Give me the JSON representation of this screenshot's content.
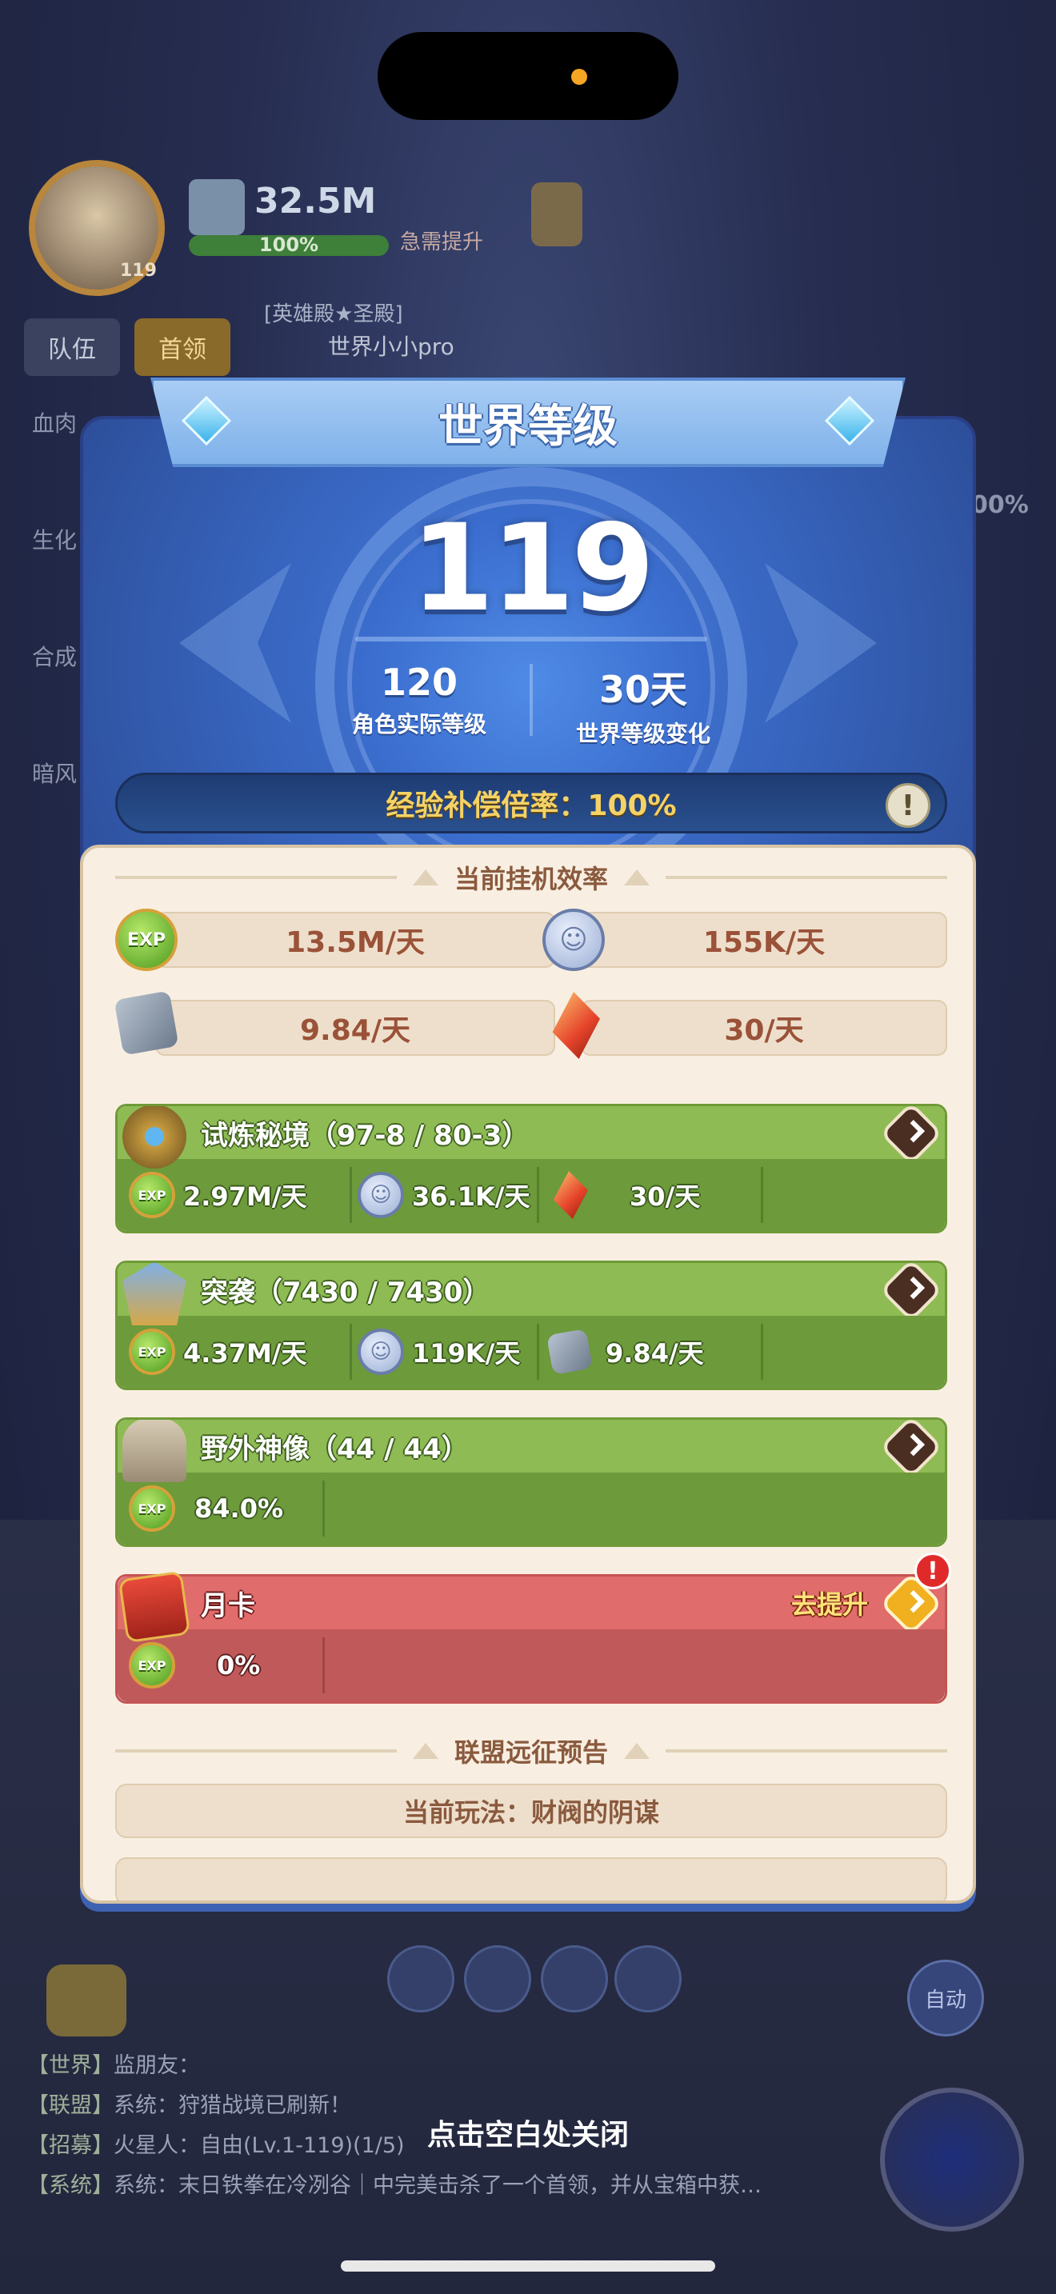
{
  "hud": {
    "level": "119",
    "power": "32.5M",
    "power_pct": "100%",
    "boost": "急需提升",
    "tabs": [
      "队伍",
      "首领"
    ],
    "guild_line1": "[英雄殿★圣殿]",
    "guild_line2": "世界小小pro",
    "side_labels": [
      "血肉",
      "生化",
      "合成",
      "暗风"
    ],
    "side_pct": "00%",
    "auto": "自动"
  },
  "modal": {
    "title": "世界等级",
    "world_level": "119",
    "actual_level_value": "120",
    "actual_level_label": "角色实际等级",
    "change_value": "30天",
    "change_label": "世界等级变化",
    "exp_rate": "经验补偿倍率：100%",
    "warn": "!",
    "efficiency_title": "当前挂机效率",
    "efficiency": {
      "exp": "13.5M/天",
      "coin": "155K/天",
      "stone": "9.84/天",
      "crystal": "30/天"
    },
    "cards": [
      {
        "title": "试炼秘境（97-8 / 80-3）",
        "items": [
          {
            "icon": "exp-icon",
            "value": "2.97M/天"
          },
          {
            "icon": "coin-icon",
            "value": "36.1K/天"
          },
          {
            "icon": "crystal-icon",
            "value": "30/天"
          }
        ]
      },
      {
        "title": "突袭（7430 / 7430）",
        "items": [
          {
            "icon": "exp-icon",
            "value": "4.37M/天"
          },
          {
            "icon": "coin-icon",
            "value": "119K/天"
          },
          {
            "icon": "stone-icon",
            "value": "9.84/天"
          }
        ]
      },
      {
        "title": "野外神像（44 / 44）",
        "items": [
          {
            "icon": "exp-icon",
            "value": "84.0%"
          }
        ]
      },
      {
        "title": "月卡",
        "upgrade": "去提升",
        "alert": "!",
        "items": [
          {
            "icon": "exp-icon",
            "value": "0%"
          }
        ]
      }
    ],
    "alliance_title": "联盟远征预告",
    "alliance_current": "当前玩法：财阀的阴谋"
  },
  "chat": [
    {
      "channel": "【世界】",
      "text": "监朋友："
    },
    {
      "channel": "【联盟】",
      "text": "系统：狩猎战境已刷新！"
    },
    {
      "channel": "【招募】",
      "text": "火星人：自由(Lv.1-119)(1/5)"
    },
    {
      "channel": "【系统】",
      "text": "系统：末日铁拳在冷冽谷｜中完美击杀了一个首领，并从宝箱中获…"
    }
  ],
  "close_hint": "点击空白处关闭",
  "colors": {
    "panel_blue": "#3968c4",
    "card_green": "#8fbb54",
    "card_red": "#e06c6c",
    "cream": "#f8efe2",
    "gold_text": "#f4d266"
  }
}
